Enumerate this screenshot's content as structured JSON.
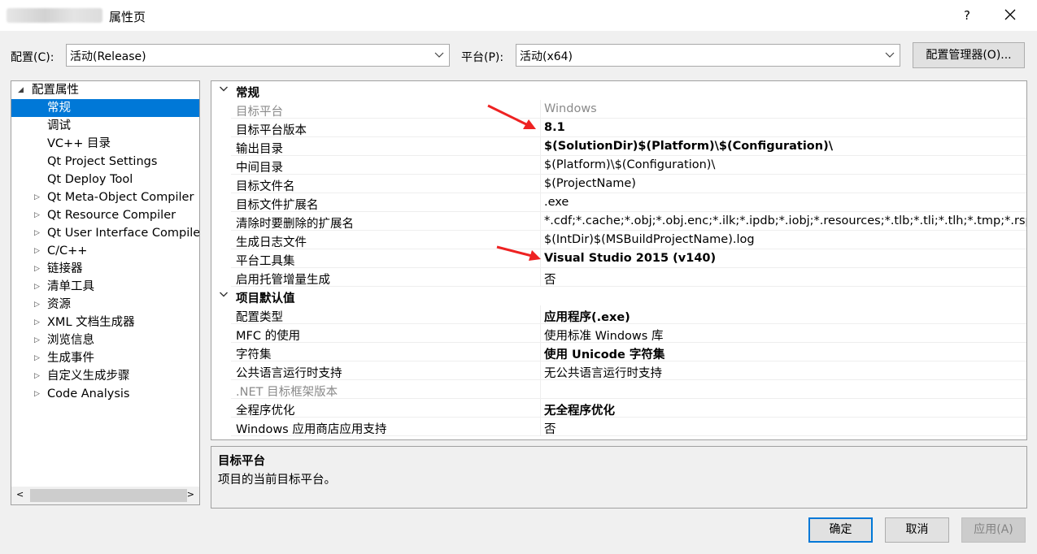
{
  "window": {
    "title": "属性页",
    "help": "?"
  },
  "toolbar": {
    "config_label": "配置(C):",
    "config_value": "活动(Release)",
    "platform_label": "平台(P):",
    "platform_value": "活动(x64)",
    "config_manager_label": "配置管理器(O)..."
  },
  "tree": {
    "root": "配置属性",
    "items": [
      {
        "label": "常规",
        "expandable": false,
        "selected": true
      },
      {
        "label": "调试",
        "expandable": false
      },
      {
        "label": "VC++ 目录",
        "expandable": false
      },
      {
        "label": "Qt Project Settings",
        "expandable": false
      },
      {
        "label": "Qt Deploy Tool",
        "expandable": false
      },
      {
        "label": "Qt Meta-Object Compiler",
        "expandable": true
      },
      {
        "label": "Qt Resource Compiler",
        "expandable": true
      },
      {
        "label": "Qt User Interface Compiler",
        "expandable": true
      },
      {
        "label": "C/C++",
        "expandable": true
      },
      {
        "label": "链接器",
        "expandable": true
      },
      {
        "label": "清单工具",
        "expandable": true
      },
      {
        "label": "资源",
        "expandable": true
      },
      {
        "label": "XML 文档生成器",
        "expandable": true
      },
      {
        "label": "浏览信息",
        "expandable": true
      },
      {
        "label": "生成事件",
        "expandable": true
      },
      {
        "label": "自定义生成步骤",
        "expandable": true
      },
      {
        "label": "Code Analysis",
        "expandable": true
      }
    ]
  },
  "grid": {
    "categories": [
      {
        "title": "常规",
        "rows": [
          {
            "name": "目标平台",
            "value": "Windows",
            "disabled": true
          },
          {
            "name": "目标平台版本",
            "value": "8.1",
            "bold": true
          },
          {
            "name": "输出目录",
            "value": "$(SolutionDir)$(Platform)\\$(Configuration)\\",
            "bold": true
          },
          {
            "name": "中间目录",
            "value": "$(Platform)\\$(Configuration)\\"
          },
          {
            "name": "目标文件名",
            "value": "$(ProjectName)"
          },
          {
            "name": "目标文件扩展名",
            "value": ".exe"
          },
          {
            "name": "清除时要删除的扩展名",
            "value": "*.cdf;*.cache;*.obj;*.obj.enc;*.ilk;*.ipdb;*.iobj;*.resources;*.tlb;*.tli;*.tlh;*.tmp;*.rsp;"
          },
          {
            "name": "生成日志文件",
            "value": "$(IntDir)$(MSBuildProjectName).log"
          },
          {
            "name": "平台工具集",
            "value": "Visual Studio 2015 (v140)",
            "bold": true
          },
          {
            "name": "启用托管增量生成",
            "value": "否"
          }
        ]
      },
      {
        "title": "项目默认值",
        "rows": [
          {
            "name": "配置类型",
            "value": "应用程序(.exe)",
            "bold": true
          },
          {
            "name": "MFC 的使用",
            "value": "使用标准 Windows 库"
          },
          {
            "name": "字符集",
            "value": "使用 Unicode 字符集",
            "bold": true
          },
          {
            "name": "公共语言运行时支持",
            "value": "无公共语言运行时支持"
          },
          {
            "name": ".NET 目标框架版本",
            "value": "",
            "disabled": true
          },
          {
            "name": "全程序优化",
            "value": "无全程序优化",
            "bold": true
          },
          {
            "name": "Windows 应用商店应用支持",
            "value": "否"
          }
        ]
      }
    ]
  },
  "description": {
    "title": "目标平台",
    "text": "项目的当前目标平台。"
  },
  "buttons": {
    "ok": "确定",
    "cancel": "取消",
    "apply": "应用(A)"
  },
  "colors": {
    "annotation_arrow": "#ee2222",
    "selection": "#0078d7"
  }
}
